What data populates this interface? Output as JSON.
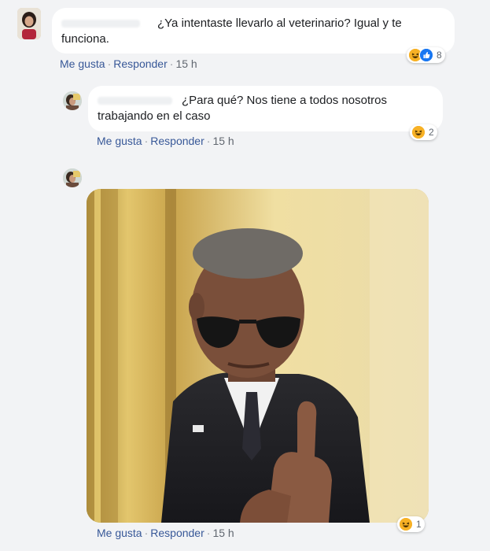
{
  "comments": [
    {
      "text": "¿Ya intentaste llevarlo al veterinario? Igual y te funciona.",
      "actions": {
        "like": "Me gusta",
        "reply": "Responder",
        "time": "15 h"
      },
      "reactions": {
        "icons": [
          "haha-icon",
          "like-icon"
        ],
        "count": "8"
      }
    },
    {
      "text": "¿Para qué? Nos tiene a todos nosotros trabajando en el caso",
      "actions": {
        "like": "Me gusta",
        "reply": "Responder",
        "time": "15 h"
      },
      "reactions": {
        "icons": [
          "haha-icon"
        ],
        "count": "2"
      }
    },
    {
      "attachment": "gif-image",
      "actions": {
        "like": "Me gusta",
        "reply": "Responder",
        "time": "15 h"
      },
      "reactions": {
        "icons": [
          "haha-icon"
        ],
        "count": "1"
      }
    }
  ],
  "separator": "·",
  "colors": {
    "link": "#385898",
    "background": "#f2f3f5",
    "bubble": "#ffffff",
    "haha": "#f7b125",
    "like": "#1877f2"
  }
}
